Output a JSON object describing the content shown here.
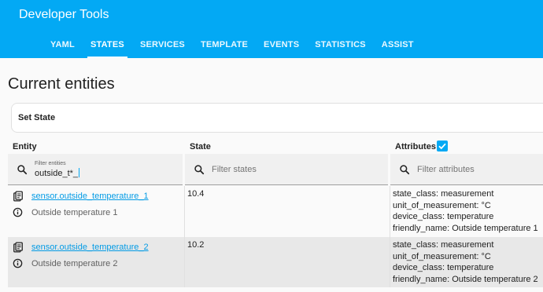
{
  "app": {
    "title": "Developer Tools"
  },
  "tabs": [
    {
      "label": "YAML",
      "active": false
    },
    {
      "label": "STATES",
      "active": true
    },
    {
      "label": "SERVICES",
      "active": false
    },
    {
      "label": "TEMPLATE",
      "active": false
    },
    {
      "label": "EVENTS",
      "active": false
    },
    {
      "label": "STATISTICS",
      "active": false
    },
    {
      "label": "ASSIST",
      "active": false
    }
  ],
  "page": {
    "title": "Current entities",
    "set_state_label": "Set State"
  },
  "columns": {
    "entity": "Entity",
    "state": "State",
    "attributes": "Attributes",
    "attributes_checked": true
  },
  "filters": {
    "entity": {
      "floating_label": "Filter entities",
      "value": "outside_t*_"
    },
    "state": {
      "placeholder": "Filter states"
    },
    "attributes": {
      "placeholder": "Filter attributes"
    }
  },
  "rows": [
    {
      "entity_id": "sensor.outside_temperature_1",
      "friendly_name": "Outside temperature 1",
      "state": "10.4",
      "attributes": [
        "state_class: measurement",
        "unit_of_measurement: °C",
        "device_class: temperature",
        "friendly_name: Outside temperature 1"
      ]
    },
    {
      "entity_id": "sensor.outside_temperature_2",
      "friendly_name": "Outside temperature 2",
      "state": "10.2",
      "attributes": [
        "state_class: measurement",
        "unit_of_measurement: °C",
        "device_class: temperature",
        "friendly_name: Outside temperature 2"
      ]
    }
  ],
  "colors": {
    "primary": "#03a9f4",
    "link": "#039be5",
    "alt_row": "#e8e8e8"
  }
}
